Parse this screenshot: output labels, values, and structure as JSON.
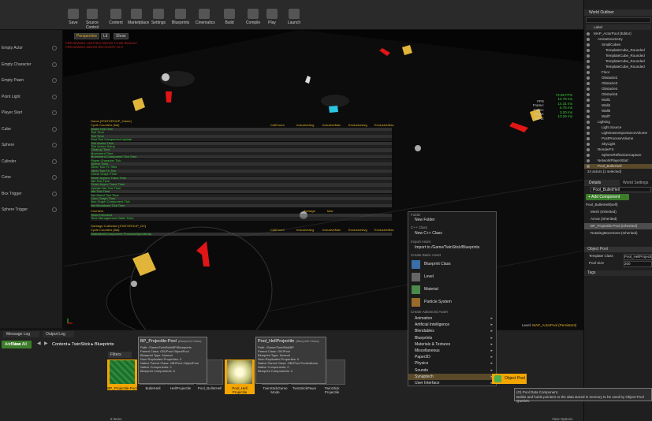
{
  "toolbar": {
    "buttons": [
      {
        "label": "Save",
        "icon": "save-icon"
      },
      {
        "label": "Source Control",
        "icon": "source-control-icon"
      },
      {
        "label": "Content",
        "icon": "content-icon"
      },
      {
        "label": "Marketplace",
        "icon": "marketplace-icon"
      },
      {
        "label": "Settings",
        "icon": "gear-icon"
      },
      {
        "label": "Blueprints",
        "icon": "blueprint-icon"
      },
      {
        "label": "Cinematics",
        "icon": "clapper-icon"
      },
      {
        "label": "Build",
        "icon": "build-icon"
      },
      {
        "label": "Compile",
        "icon": "compile-icon"
      },
      {
        "label": "Play",
        "icon": "play-icon"
      },
      {
        "label": "Launch",
        "icon": "launch-icon"
      }
    ]
  },
  "left_panel": {
    "items": [
      "Empty Actor",
      "Empty Character",
      "Empty Pawn",
      "Point Light",
      "Player Start",
      "Cube",
      "Sphere",
      "Cylinder",
      "Cone",
      "Box Trigger",
      "Sphere Trigger"
    ]
  },
  "viewport": {
    "buttons": [
      "Perspective",
      "Lit",
      "Show"
    ],
    "warnings": [
      "PREVIEWING LIGHTING NEEDS TO BE REBUILT",
      "PREVIEWING NEEDS RECOVERY OUT"
    ],
    "fps_box": [
      "FPS",
      "Frame:",
      "Game:",
      "Draw:",
      "GPU:"
    ],
    "fps_values": [
      "72.55 FPS",
      "13.78 ms",
      "14.31 ms",
      "5.75 ms",
      "3.20 ms",
      "13.29 ms"
    ],
    "level_label": "Level:",
    "level_value": "MAP_ActorPool (Persistent)",
    "stat_title": "Game [STATGROUP_Game]",
    "stat_subtitle": "Cycle Counters (flat)",
    "stat_cols": [
      "CallCount",
      "InclusiveAvg",
      "InclusiveMax",
      "ExclusiveAvg",
      "ExclusiveMax"
    ],
    "stat_rows": [
      "World Tick Time",
      "Tick Time",
      "Tick Time",
      "Post Tick Component Update",
      "Tick Actors Time",
      "Tick Actors Setup",
      "Cleanup Time",
      "Movement Time",
      "Movement Component Tick Time",
      "Player Character Tick",
      "Queue Ticks",
      "Other Tick Fx Tiles",
      "Other Tick Fn Tick",
      "Check Graph Time",
      "Reset Asyncs Trace Time",
      "Net Tick Time",
      "Finish Async Trace Time",
      "Update Net Tick Time",
      "Net Tick Time",
      "Net World Tick Time",
      "Conv Graph Time",
      "Non Graph Component Tick",
      "Net Broadcast Tick Time"
    ],
    "counters_title": "Counters",
    "counters_cols": [
      "Average",
      "Max"
    ],
    "counter_rows": [
      "Ticks Executed",
      "Time Management Stalls Ticks"
    ],
    "gc_title": "Garbage Collection [STATGROUP_GC]",
    "gc_subtitle": "Cycle Counters (flat)",
    "gc_rows": [
      "StaticMeshComponent ProcessObjectArray"
    ]
  },
  "outliner": {
    "title": "World Outliner",
    "search_label": "Label",
    "items": [
      {
        "label": "MAP_ActorPool (Editor)",
        "indent": 0
      },
      {
        "label": "ArenaGeometry",
        "indent": 1
      },
      {
        "label": "SmallCubes",
        "indent": 2
      },
      {
        "label": "TemplateCube_Rounded",
        "indent": 3
      },
      {
        "label": "TemplateCube_Rounded",
        "indent": 3
      },
      {
        "label": "TemplateCube_Rounded",
        "indent": 3
      },
      {
        "label": "TemplateCube_Rounded",
        "indent": 3
      },
      {
        "label": "Floor",
        "indent": 2
      },
      {
        "label": "Obstacle2",
        "indent": 2
      },
      {
        "label": "Obstacle3",
        "indent": 2
      },
      {
        "label": "Obstacle4",
        "indent": 2
      },
      {
        "label": "Obstacle5",
        "indent": 2
      },
      {
        "label": "Wall1",
        "indent": 2
      },
      {
        "label": "Wall4",
        "indent": 2
      },
      {
        "label": "Wall5",
        "indent": 2
      },
      {
        "label": "Wall7",
        "indent": 2
      },
      {
        "label": "Lighting",
        "indent": 1
      },
      {
        "label": "Light Source",
        "indent": 2
      },
      {
        "label": "LightmassImportanceVolume",
        "indent": 2
      },
      {
        "label": "PostProcessVolume",
        "indent": 2
      },
      {
        "label": "SkyLight",
        "indent": 2
      },
      {
        "label": "RenderFX",
        "indent": 1
      },
      {
        "label": "SphereReflectionCapture",
        "indent": 2
      },
      {
        "label": "NetworkPlayerStart",
        "indent": 1
      },
      {
        "label": "Pool_BulletHell",
        "indent": 1
      }
    ],
    "count": "24 actors (1 selected)"
  },
  "details": {
    "tab": "Details",
    "tab2": "World Settings",
    "name": "Pool_BulletHell",
    "add_component": "+ Add Component",
    "self_label": "Pool_BulletHell(self)",
    "components": [
      "Mesh (Inherited)",
      "Arrow (Inherited)",
      "BP_Projectile-Pool (Inherited)",
      "RotatingMovement (Inherited)"
    ],
    "section": "Object Pool",
    "props": [
      {
        "label": "Template Class",
        "value": "Pool_HellProjectile"
      },
      {
        "label": "Pool Size",
        "value": "200"
      }
    ],
    "tags_label": "Tags"
  },
  "content": {
    "tabs": [
      "Message Log",
      "Output Log"
    ],
    "add_new": "Add New",
    "save_all": "Save All",
    "breadcrumb": [
      "Content",
      "TwinStick",
      "Blueprints"
    ],
    "filters": "Filters",
    "assets": [
      {
        "label": "BP_Projectile-Pool",
        "sel": true
      },
      {
        "label": "BulletHell",
        "sel": false
      },
      {
        "label": "HellProjectile",
        "sel": false
      },
      {
        "label": "Pool_BulletHell",
        "sel": false
      },
      {
        "label": "Pool_Hell Projectile",
        "sel": true
      },
      {
        "label": "TwinStickGame Mode",
        "sel": false
      },
      {
        "label": "TwinStickPawn",
        "sel": false
      },
      {
        "label": "TwinStick Projectile",
        "sel": false
      }
    ],
    "items_count": "8 items",
    "view_options": "View Options",
    "tooltip1": {
      "title": "BP_Projectile-Pool",
      "type": "(Blueprint Class)",
      "lines": [
        "Path: /Game/TwinStickBP/Blueprints",
        "Parent Class: OBJPool ObjectPool",
        "Blueprint Type: Normal",
        "Num Replicated Properties: 0",
        "Native Parent Class: OBJPool ObjectPool",
        "Native Components: 0",
        "Blueprint Components: 0"
      ]
    },
    "tooltip2": {
      "title": "Pool_HellProjectile",
      "type": "(Blueprint Class)",
      "lines": [
        "Path: /Game/TwinStickBP",
        "Parent Class: OBJPool",
        "Blueprint Type: Normal",
        "Num Replicated Properties: 0",
        "Native Parent Class: OBJPool PooledActor",
        "Native Components: 0",
        "Blueprint Components: 0"
      ]
    }
  },
  "context_menu": {
    "folder_header": "Folder",
    "new_folder": "New Folder",
    "cpp_header": "C++ Class",
    "new_cpp": "New C++ Class",
    "import_header": "Import Asset",
    "import": "Import to /Game/TwinStick/Blueprints",
    "basic_header": "Create Basic Asset",
    "basic": [
      "Blueprint Class",
      "Level",
      "Material",
      "Particle System"
    ],
    "advanced_header": "Create Advanced Asset",
    "advanced": [
      "Animation",
      "Artificial Intelligence",
      "Blendables",
      "Blueprints",
      "Materials & Textures",
      "Miscellaneous",
      "Paper2D",
      "Physics",
      "Sounds",
      "Synaptech",
      "User Interface"
    ],
    "submenu": "Object Pool",
    "submenu_tip": [
      "(O) Pool Data Component.",
      "Builds and holds pointers to the data stored in memory to be used by Object-Pool Queries."
    ]
  },
  "colors": {
    "accent": "#f3a600",
    "stat_green": "#3bd13b",
    "stat_yellow": "#e3b22b",
    "selection": "#5a4a2a",
    "arrow_red": "#e01515",
    "cube_yellow": "#e0b53a",
    "cube_cyan": "#29c6e0"
  }
}
